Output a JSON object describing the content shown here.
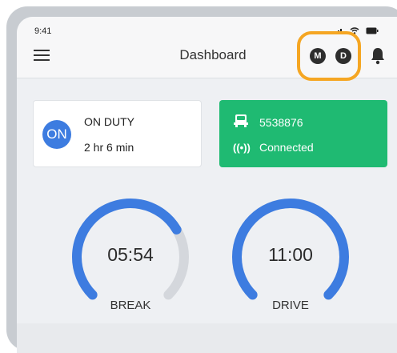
{
  "status_bar": {
    "time": "9:41",
    "icons": [
      "signal-icon",
      "wifi-icon",
      "battery-icon"
    ]
  },
  "header": {
    "title": "Dashboard",
    "menu_icon": "hamburger-menu-icon",
    "badge_m": "M",
    "badge_d": "D",
    "bell_icon": "bell-icon"
  },
  "duty_card": {
    "badge": "ON",
    "label": "ON DUTY",
    "time": "2 hr 6 min"
  },
  "vehicle_card": {
    "icon": "truck-icon",
    "vehicle_id": "5538876",
    "connection_icon": "broadcast-icon",
    "connection_status": "Connected"
  },
  "gauges": {
    "break": {
      "value": "05:54",
      "label": "BREAK",
      "fill_fraction": 0.72
    },
    "drive": {
      "value": "11:00",
      "label": "DRIVE",
      "fill_fraction": 1.0
    }
  },
  "colors": {
    "accent_blue": "#3d7ce0",
    "connected_green": "#1fba72",
    "highlight_orange": "#f5a623",
    "gauge_track": "#d4d7dc"
  }
}
